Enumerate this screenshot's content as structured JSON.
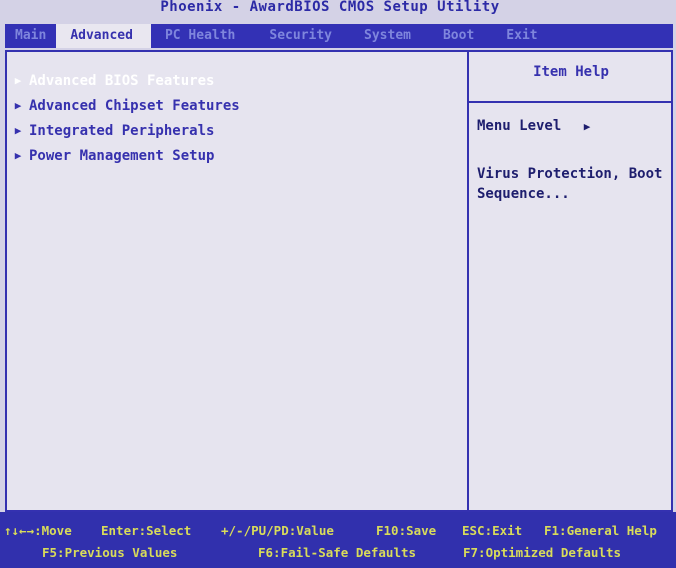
{
  "window": {
    "title": "Phoenix - AwardBIOS CMOS Setup Utility"
  },
  "menubar": {
    "tabs": [
      {
        "label": "Main",
        "active": false
      },
      {
        "label": "Advanced",
        "active": true
      },
      {
        "label": "PC Health",
        "active": false
      },
      {
        "label": "Security",
        "active": false
      },
      {
        "label": "System",
        "active": false
      },
      {
        "label": "Boot",
        "active": false
      },
      {
        "label": "Exit",
        "active": false
      }
    ]
  },
  "main": {
    "items": [
      {
        "label": "Advanced BIOS Features",
        "selected": true,
        "icon": "triangle-right-icon"
      },
      {
        "label": "Advanced Chipset Features",
        "selected": false,
        "icon": "triangle-right-icon"
      },
      {
        "label": "Integrated Peripherals",
        "selected": false,
        "icon": "triangle-right-icon"
      },
      {
        "label": "Power Management Setup",
        "selected": false,
        "icon": "triangle-right-icon"
      }
    ]
  },
  "help": {
    "title": "Item Help",
    "menu_level_label": "Menu Level",
    "menu_level_icon": "triangle-right-icon",
    "description_line1": "Virus Protection, Boot",
    "description_line2": "Sequence..."
  },
  "footer": {
    "row1": [
      "↑↓←→:Move",
      "Enter:Select",
      "+/-/PU/PD:Value",
      "F10:Save",
      "ESC:Exit",
      "F1:General Help"
    ],
    "row2": [
      "F5:Previous Values",
      "F6:Fail-Safe Defaults",
      "F7:Optimized Defaults"
    ]
  },
  "colors": {
    "background": "#d4d2e6",
    "menubar": "#3331b5",
    "text_blue": "#3631ae",
    "selected_text": "#ffffff",
    "footer_text": "#d9dc5a"
  }
}
